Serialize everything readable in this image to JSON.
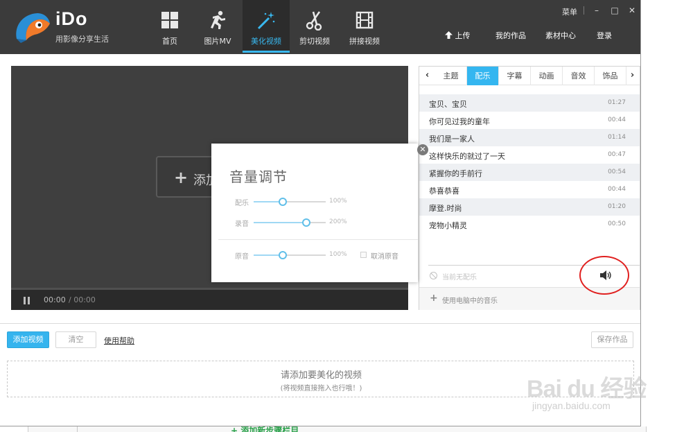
{
  "brand": {
    "name": "iDo",
    "slogan": "用影像分享生活"
  },
  "nav": [
    {
      "label": "首页",
      "icon": "grid-icon",
      "active": false
    },
    {
      "label": "图片MV",
      "icon": "runner-icon",
      "active": false
    },
    {
      "label": "美化视频",
      "icon": "magic-wand-icon",
      "active": true
    },
    {
      "label": "剪切视频",
      "icon": "scissors-icon",
      "active": false
    },
    {
      "label": "拼接视频",
      "icon": "film-strip-icon",
      "active": false
    }
  ],
  "window": {
    "menu_label": "菜单",
    "minimize": "–",
    "maximize": "□",
    "close": "✕"
  },
  "top_links": {
    "upload": "上传",
    "my_works": "我的作品",
    "materials": "素材中心",
    "login": "登录"
  },
  "preview": {
    "add_video_label": "添加",
    "time_current": "00:00",
    "time_total": "/ 00:00"
  },
  "volume": {
    "title": "音量调节",
    "rows": [
      {
        "label": "配乐",
        "value_text": "100%",
        "level": 0.4
      },
      {
        "label": "录音",
        "value_text": "200%",
        "level": 0.73
      },
      {
        "label": "原音",
        "value_text": "100%",
        "level": 0.4
      }
    ],
    "mute_label": "取消原音",
    "close_symbol": "✕"
  },
  "panel": {
    "tabs": [
      "主题",
      "配乐",
      "字幕",
      "动画",
      "音效",
      "饰品"
    ],
    "active_tab": 1,
    "prev_arrow": "‹",
    "next_arrow": "›",
    "music": [
      {
        "name": "宝贝、宝贝",
        "duration": "01:27"
      },
      {
        "name": "你可见过我的童年",
        "duration": "00:44"
      },
      {
        "name": "我们是一家人",
        "duration": "01:14"
      },
      {
        "name": "这样快乐的就过了一天",
        "duration": "00:47"
      },
      {
        "name": "紧握你的手前行",
        "duration": "00:54"
      },
      {
        "name": "恭喜恭喜",
        "duration": "00:44"
      },
      {
        "name": "摩登.时尚",
        "duration": "01:20"
      },
      {
        "name": "宠物小精灵",
        "duration": "00:50"
      }
    ],
    "no_music_text": "当前无配乐",
    "use_local_music": "使用电脑中的音乐"
  },
  "toolbar": {
    "add_video": "添加视频",
    "clear": "清空",
    "help": "使用帮助",
    "save": "保存作品"
  },
  "drop_zone": {
    "main": "请添加要美化的视频",
    "sub": "(将视频直接拖入也行哦！)"
  },
  "behind": {
    "text": "+ 添加新步骤栏目"
  },
  "watermark": {
    "main": "Bai du 经验",
    "sub": "jingyan.baidu.com"
  },
  "colors": {
    "accent": "#34b6f0",
    "header_bg": "#3b3b3b",
    "highlight": "#e0201f"
  }
}
